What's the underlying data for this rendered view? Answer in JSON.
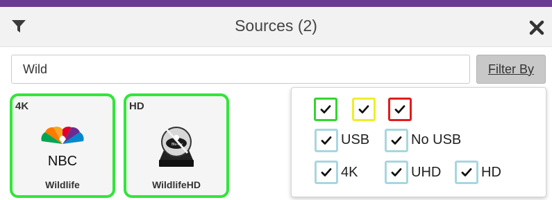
{
  "header": {
    "title": "Sources (2)",
    "filter_icon": "filter-icon",
    "close_icon": "close-icon"
  },
  "search": {
    "value": "Wild",
    "placeholder": ""
  },
  "filter_button": {
    "label": "Filter By"
  },
  "sources": [
    {
      "badge": "4K",
      "name": "Wildlife",
      "logo": "nbc-peacock-logo"
    },
    {
      "badge": "HD",
      "name": "WildlifeHD",
      "logo": "bluray-disc-logo"
    }
  ],
  "filter_panel": {
    "status_filters": [
      {
        "color": "green",
        "hex": "#33d62e",
        "checked": true
      },
      {
        "color": "yellow",
        "hex": "#eeee2a",
        "checked": true
      },
      {
        "color": "red",
        "hex": "#e21c1c",
        "checked": true
      }
    ],
    "usb_filters": [
      {
        "label": "USB",
        "checked": true
      },
      {
        "label": "No USB",
        "checked": true
      }
    ],
    "resolution_filters": [
      {
        "label": "4K",
        "checked": true
      },
      {
        "label": "UHD",
        "checked": true
      },
      {
        "label": "HD",
        "checked": true
      }
    ]
  },
  "colors": {
    "accent_bar": "#6b3a92",
    "tile_border": "#33e53a",
    "checkbox_border": "#a8d6e0"
  }
}
